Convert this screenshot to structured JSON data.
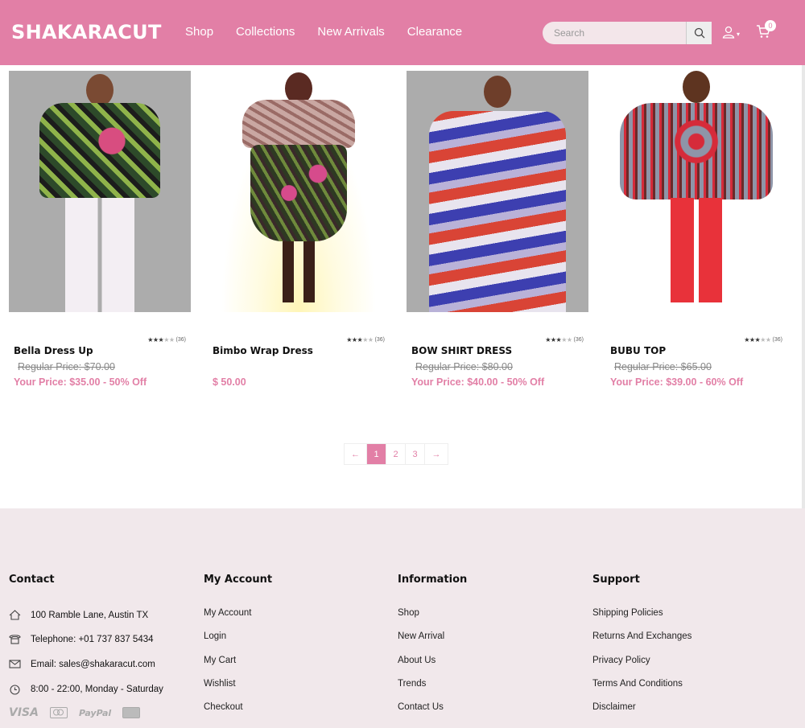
{
  "header": {
    "logo": "SHAKARACUT",
    "nav": [
      "Shop",
      "Collections",
      "New Arrivals",
      "Clearance"
    ],
    "search_placeholder": "Search",
    "cart_count": "0",
    "brand_color": "#e27fa6"
  },
  "products": [
    {
      "name": "Bella Dress Up",
      "rating_count": "(36)",
      "stars": 3,
      "regular": "Regular Price:  $70.00",
      "price": "Your Price:  $35.00  -  50% Off"
    },
    {
      "name": "Bimbo Wrap Dress",
      "rating_count": "(36)",
      "stars": 3,
      "regular": "",
      "price": "$ 50.00"
    },
    {
      "name": "BOW SHIRT DRESS",
      "rating_count": "(36)",
      "stars": 3,
      "regular": "Regular Price:  $80.00",
      "price": "Your Price:  $40.00  -  50% Off"
    },
    {
      "name": "BUBU TOP",
      "rating_count": "(36)",
      "stars": 3,
      "regular": "Regular Price:  $65.00",
      "price": "Your Price:  $39.00  -  60% Off"
    }
  ],
  "pagination": {
    "prev": "←",
    "pages": [
      "1",
      "2",
      "3"
    ],
    "next": "→",
    "current": "1"
  },
  "footer": {
    "contact": {
      "title": "Contact",
      "address": "100 Ramble Lane, Austin TX",
      "phone": "Telephone: +01 737 837 5434",
      "email": "Email: sales@shakaracut.com",
      "hours": "8:00 - 22:00, Monday - Saturday"
    },
    "account": {
      "title": "My Account",
      "links": [
        "My Account",
        "Login",
        "My Cart",
        "Wishlist",
        "Checkout"
      ]
    },
    "information": {
      "title": "Information",
      "links": [
        "Shop",
        "New Arrival",
        "About Us",
        "Trends",
        "Contact Us"
      ]
    },
    "support": {
      "title": "Support",
      "links": [
        "Shipping Policies",
        "Returns And Exchanges",
        "Privacy Policy",
        "Terms And Conditions",
        "Disclaimer"
      ]
    },
    "payments": [
      "VISA",
      "mastercard",
      "PayPal",
      "discover"
    ]
  }
}
